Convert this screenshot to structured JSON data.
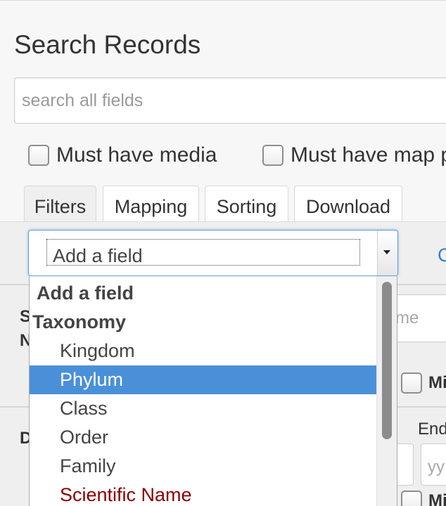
{
  "page": {
    "title": "Search Records"
  },
  "search": {
    "placeholder": "search all fields"
  },
  "options": {
    "media_label": "Must have media",
    "map_label": "Must have map p"
  },
  "tabs": [
    {
      "label": "Filters"
    },
    {
      "label": "Mapping"
    },
    {
      "label": "Sorting"
    },
    {
      "label": "Download"
    }
  ],
  "field_select": {
    "value": "Add a field"
  },
  "dropdown": {
    "items": [
      {
        "label": "Add a field"
      },
      {
        "label": "Taxonomy"
      },
      {
        "label": "Kingdom"
      },
      {
        "label": "Phylum"
      },
      {
        "label": "Class"
      },
      {
        "label": "Order"
      },
      {
        "label": "Family"
      },
      {
        "label": "Scientific Name"
      }
    ],
    "highlighted": "Phylum"
  },
  "background_fragments": {
    "link_char": "C",
    "row1_s": "S",
    "row1_n": "N",
    "name_placeholder_frag": "me",
    "mi_label_1": "Mi",
    "row2_d": "D",
    "end_label_frag": "End",
    "date_placeholder_frag": "yy",
    "mi_label_2": "Mi"
  },
  "colors": {
    "accent": "#4a90d9",
    "link": "#3a7ec6",
    "special_item": "#8b0000"
  }
}
